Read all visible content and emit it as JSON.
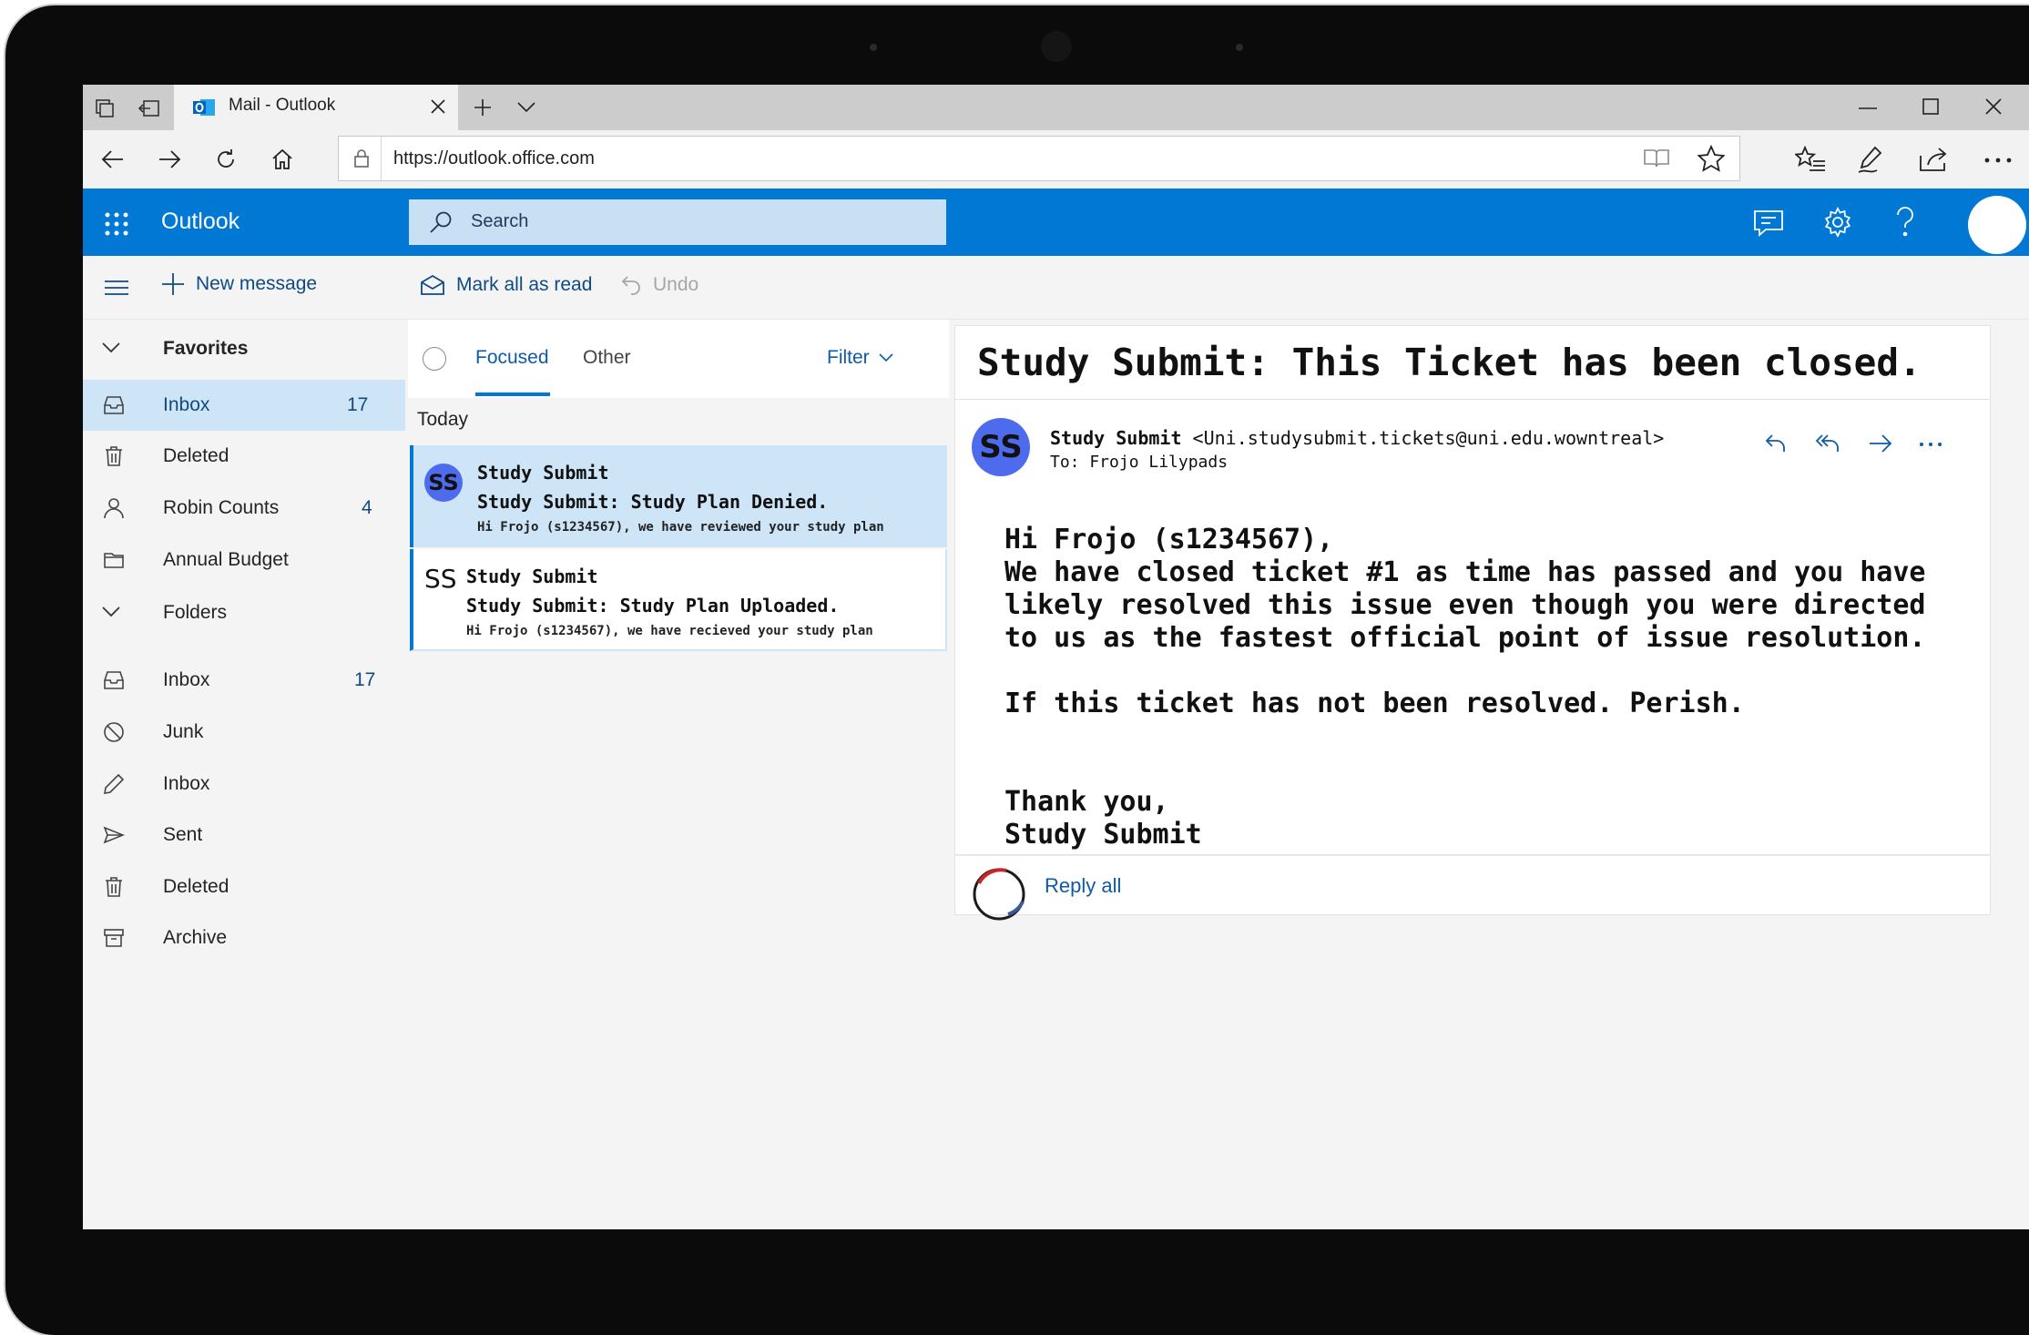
{
  "browser": {
    "tab_title": "Mail - Outlook",
    "url": "https://outlook.office.com"
  },
  "header": {
    "brand": "Outlook",
    "search_label": "Search"
  },
  "commands": {
    "new_message": "New message",
    "mark_all_read": "Mark all as read",
    "undo": "Undo"
  },
  "sidebar": {
    "favorites_label": "Favorites",
    "folders_label": "Folders",
    "favorites": [
      {
        "label": "Inbox",
        "count": "17",
        "icon": "inbox-icon"
      },
      {
        "label": "Deleted",
        "count": "",
        "icon": "trash-icon"
      },
      {
        "label": "Robin Counts",
        "count": "4",
        "icon": "person-icon"
      },
      {
        "label": "Annual Budget",
        "count": "",
        "icon": "folder-icon"
      }
    ],
    "folders": [
      {
        "label": "Inbox",
        "count": "17",
        "icon": "inbox-icon"
      },
      {
        "label": "Junk",
        "count": "",
        "icon": "blocked-icon"
      },
      {
        "label": "Inbox",
        "count": "",
        "icon": "pencil-icon"
      },
      {
        "label": "Sent",
        "count": "",
        "icon": "send-icon"
      },
      {
        "label": "Deleted",
        "count": "",
        "icon": "trash-icon"
      },
      {
        "label": "Archive",
        "count": "",
        "icon": "archive-icon"
      }
    ]
  },
  "message_list": {
    "tab_focused": "Focused",
    "tab_other": "Other",
    "filter": "Filter",
    "group_today": "Today",
    "messages": [
      {
        "initials": "SS",
        "sender": "Study Submit",
        "subject": "Study Submit: Study Plan Denied.",
        "preview": "Hi Frojo (s1234567), we have reviewed your study plan"
      },
      {
        "initials": "SS",
        "sender": "Study Submit",
        "subject": "Study Submit: Study Plan Uploaded.",
        "preview": "Hi Frojo (s1234567), we have recieved your study plan"
      }
    ]
  },
  "reading": {
    "subject": "Study Submit: This Ticket has been closed.",
    "avatar_initials": "SS",
    "from_name": "Study Submit",
    "from_email": "<Uni.studysubmit.tickets@uni.edu.wowntreal>",
    "to_line": "To: Frojo Lilypads",
    "body_lines": [
      "Hi Frojo (s1234567),",
      "We have closed ticket #1 as time has passed and you have",
      "likely resolved this issue even though you were directed",
      "to us as the fastest official point of issue resolution.",
      "",
      "If this ticket has not been resolved. Perish.",
      "",
      "",
      "Thank you,",
      "Study Submit"
    ],
    "reply_all": "Reply all"
  },
  "colors": {
    "accent": "#0078d4",
    "search_bg": "#c7e0f4",
    "selected_bg": "#cde5f7",
    "avatar": "#4f6bed"
  }
}
